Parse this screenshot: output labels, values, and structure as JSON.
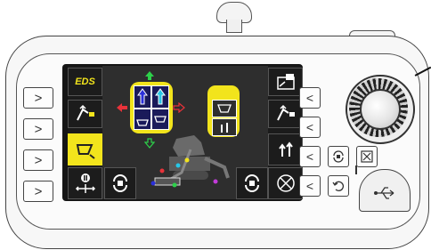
{
  "screen": {
    "top_left_label": "EDS"
  },
  "colors": {
    "accent_yellow": "#f2e41c",
    "screen_bg": "#1b1b1b",
    "arrow_green": "#2dd14a",
    "arrow_red": "#e8323a",
    "cyan": "#27c7e8",
    "blue": "#2a2fd9"
  },
  "icons": {
    "left_softkeys": [
      "eds-label",
      "boom-mode-icon",
      "bucket-mode-icon",
      "stop-arrows-icon"
    ],
    "right_softkeys": [
      "screen-export-icon",
      "boom-mode-icon",
      "dual-arrow-icon",
      "no-entry-icon"
    ],
    "bottom_left_softkey": "rotate-icon",
    "bottom_right_softkey": "rotate-icon",
    "side_button_glyph": ">",
    "right_side_button_glyph": "<"
  },
  "joystick": {
    "left_panel": "joystick-left-icon",
    "right_panel": "joystick-right-icon"
  }
}
